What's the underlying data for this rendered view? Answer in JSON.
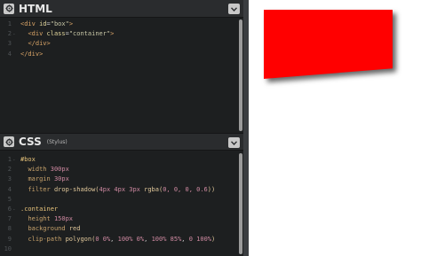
{
  "html_panel": {
    "title": "HTML",
    "lines": [
      {
        "n": "1",
        "fold": "",
        "parts": [
          [
            "tag",
            "<div "
          ],
          [
            "attr",
            "id"
          ],
          [
            "plain",
            "="
          ],
          [
            "str",
            "\"box\""
          ],
          [
            "tag",
            ">"
          ]
        ]
      },
      {
        "n": "2",
        "fold": "-",
        "parts": [
          [
            "plain",
            "  "
          ],
          [
            "tag",
            "<div "
          ],
          [
            "attr",
            "class"
          ],
          [
            "plain",
            "="
          ],
          [
            "str",
            "\"container\""
          ],
          [
            "tag",
            ">"
          ]
        ]
      },
      {
        "n": "3",
        "fold": "",
        "parts": [
          [
            "plain",
            "  "
          ],
          [
            "tag",
            "</div>"
          ]
        ]
      },
      {
        "n": "4",
        "fold": "",
        "parts": [
          [
            "tag",
            "</div>"
          ]
        ]
      }
    ]
  },
  "css_panel": {
    "title": "CSS",
    "subtitle": "(Stylus)",
    "lines": [
      {
        "n": "1",
        "fold": "-",
        "parts": [
          [
            "sel",
            "#box"
          ]
        ]
      },
      {
        "n": "2",
        "fold": "",
        "parts": [
          [
            "plain",
            "  "
          ],
          [
            "prop",
            "width "
          ],
          [
            "num",
            "300px"
          ]
        ]
      },
      {
        "n": "3",
        "fold": "",
        "parts": [
          [
            "plain",
            "  "
          ],
          [
            "prop",
            "margin "
          ],
          [
            "num",
            "30px"
          ]
        ]
      },
      {
        "n": "4",
        "fold": "",
        "parts": [
          [
            "plain",
            "  "
          ],
          [
            "prop",
            "filter "
          ],
          [
            "fn",
            "drop-shadow("
          ],
          [
            "num",
            "4px 4px 3px "
          ],
          [
            "fn",
            "rgba("
          ],
          [
            "num",
            "0, 0, 0, 0.6"
          ],
          [
            "fn",
            "))"
          ]
        ]
      },
      {
        "n": "5",
        "fold": "",
        "parts": []
      },
      {
        "n": "6",
        "fold": "-",
        "parts": [
          [
            "sel",
            ".container"
          ]
        ]
      },
      {
        "n": "7",
        "fold": "",
        "parts": [
          [
            "plain",
            "  "
          ],
          [
            "prop",
            "height "
          ],
          [
            "num",
            "150px"
          ]
        ]
      },
      {
        "n": "8",
        "fold": "",
        "parts": [
          [
            "plain",
            "  "
          ],
          [
            "prop",
            "background "
          ],
          [
            "val",
            "red"
          ]
        ]
      },
      {
        "n": "9",
        "fold": "",
        "parts": [
          [
            "plain",
            "  "
          ],
          [
            "prop",
            "clip-path "
          ],
          [
            "fn",
            "polygon("
          ],
          [
            "num",
            "0 0%"
          ],
          [
            "plain",
            ", "
          ],
          [
            "num",
            "100% 0%"
          ],
          [
            "plain",
            ", "
          ],
          [
            "num",
            "100% 85%"
          ],
          [
            "plain",
            ", "
          ],
          [
            "num",
            "0 100%"
          ],
          [
            "fn",
            ")"
          ]
        ]
      },
      {
        "n": "10",
        "fold": "",
        "parts": []
      }
    ]
  },
  "icons": {
    "settings": "gear-icon",
    "collapse": "chevron-down-icon"
  },
  "colors": {
    "editor_bg": "#1d1f20",
    "preview_shape": "#ff0000"
  }
}
